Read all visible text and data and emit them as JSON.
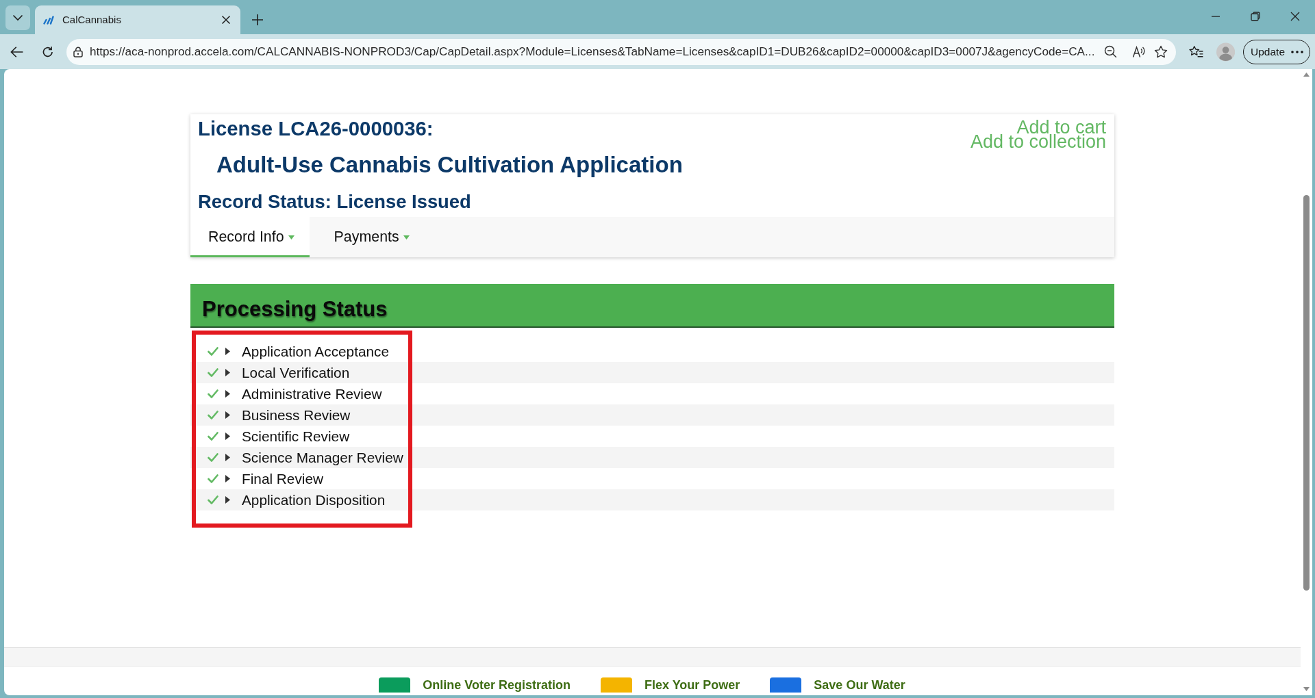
{
  "browser": {
    "tabs": [
      {
        "title": "CalCannabis",
        "selected": true
      }
    ],
    "url": "https://aca-nonprod.accela.com/CALCANNABIS-NONPROD3/Cap/CapDetail.aspx?Module=Licenses&TabName=Licenses&capID1=DUB26&capID2=00000&capID3=0007J&agencyCode=CA...",
    "update_button": "Update"
  },
  "record": {
    "license_title": "License LCA26-0000036:",
    "record_type": "Adult-Use Cannabis Cultivation Application",
    "record_status": "Record Status: License Issued",
    "actions": [
      "Add to cart",
      "Add to collection"
    ],
    "tabs": [
      {
        "label": "Record Info",
        "selected": true
      },
      {
        "label": "Payments",
        "selected": false
      }
    ]
  },
  "processing_status": {
    "title": "Processing Status",
    "highlighted": true,
    "steps": [
      {
        "label": "Application Acceptance",
        "completed": true,
        "expanded": false
      },
      {
        "label": "Local Verification",
        "completed": true,
        "expanded": false
      },
      {
        "label": "Administrative Review",
        "completed": true,
        "expanded": false
      },
      {
        "label": "Business Review",
        "completed": true,
        "expanded": false
      },
      {
        "label": "Scientific Review",
        "completed": true,
        "expanded": false
      },
      {
        "label": "Science Manager Review",
        "completed": true,
        "expanded": false
      },
      {
        "label": "Final Review",
        "completed": true,
        "expanded": false
      },
      {
        "label": "Application Disposition",
        "completed": true,
        "expanded": false
      }
    ]
  },
  "footer": {
    "links": [
      {
        "label": "Online Voter Registration",
        "color": "#0b9c5c"
      },
      {
        "label": "Flex Your Power",
        "color": "#f4b400"
      },
      {
        "label": "Save Our Water",
        "color": "#1a6fe0"
      }
    ]
  }
}
